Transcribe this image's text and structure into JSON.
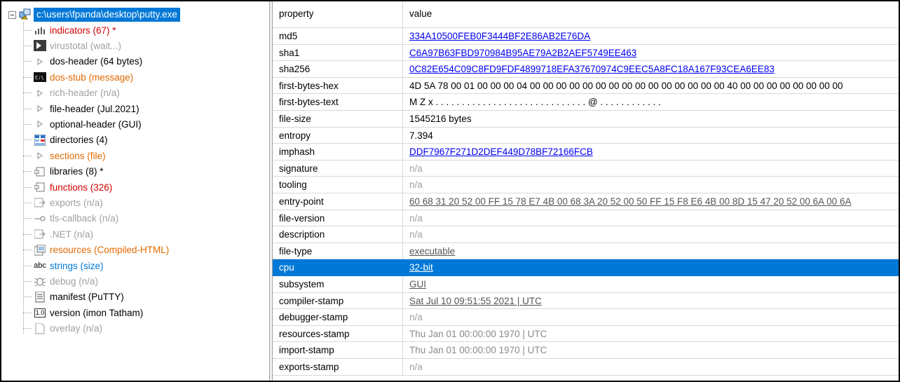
{
  "tree": {
    "root_label": "c:\\users\\fpanda\\desktop\\putty.exe",
    "items": [
      {
        "label": "indicators (67) *",
        "icon": "bars-icon",
        "color": "red"
      },
      {
        "label": "virustotal (wait...)",
        "icon": "virustotal-icon",
        "color": "gray"
      },
      {
        "label": "dos-header (64 bytes)",
        "icon": "triangle-icon",
        "color": "black"
      },
      {
        "label": "dos-stub (message)",
        "icon": "console-icon",
        "color": "orange"
      },
      {
        "label": "rich-header (n/a)",
        "icon": "triangle-icon",
        "color": "gray"
      },
      {
        "label": "file-header (Jul.2021)",
        "icon": "triangle-icon",
        "color": "black"
      },
      {
        "label": "optional-header (GUI)",
        "icon": "triangle-icon",
        "color": "black"
      },
      {
        "label": "directories (4)",
        "icon": "grid-icon",
        "color": "black"
      },
      {
        "label": "sections (file)",
        "icon": "triangle-icon",
        "color": "orange"
      },
      {
        "label": "libraries (8) *",
        "icon": "library-icon",
        "color": "black"
      },
      {
        "label": "functions (326)",
        "icon": "library-icon",
        "color": "red"
      },
      {
        "label": "exports (n/a)",
        "icon": "export-icon",
        "color": "gray"
      },
      {
        "label": "tls-callback (n/a)",
        "icon": "key-icon",
        "color": "gray"
      },
      {
        "label": ".NET (n/a)",
        "icon": "export-icon",
        "color": "gray"
      },
      {
        "label": "resources (Compiled-HTML)",
        "icon": "resources-icon",
        "color": "orange"
      },
      {
        "label": "strings (size)",
        "icon": "abc-icon",
        "color": "blue"
      },
      {
        "label": "debug (n/a)",
        "icon": "bug-icon",
        "color": "gray"
      },
      {
        "label": "manifest (PuTTY)",
        "icon": "manifest-icon",
        "color": "black"
      },
      {
        "label": "version (imon Tatham)",
        "icon": "version-icon",
        "color": "black"
      },
      {
        "label": "overlay (n/a)",
        "icon": "page-icon",
        "color": "gray"
      }
    ],
    "version_icon_text": "1.0",
    "abc_icon_text": "abc"
  },
  "table": {
    "header": {
      "property": "property",
      "value": "value"
    },
    "rows": [
      {
        "key": "md5",
        "value": "334A10500FEB0F3444BF2E86AB2E76DA",
        "style": "link"
      },
      {
        "key": "sha1",
        "value": "C6A97B63FBD970984B95AE79A2B2AEF5749EE463",
        "style": "link"
      },
      {
        "key": "sha256",
        "value": "0C82E654C09C8FD9FDF4899718EFA37670974C9EEC5A8FC18A167F93CEA6EE83",
        "style": "link"
      },
      {
        "key": "first-bytes-hex",
        "value": "4D 5A 78 00 01 00 00 00 04 00 00 00 00 00 00 00 00 00 00 00 00 00 00 00 40 00 00 00 00 00 00 00 00",
        "style": "plain"
      },
      {
        "key": "first-bytes-text",
        "value": "M Z x . . . . . . . . . . . . . . . . . . . . . . . . . . . . . @ . . . . . . . . . . . .",
        "style": "plain"
      },
      {
        "key": "file-size",
        "value": "1545216 bytes",
        "style": "plain"
      },
      {
        "key": "entropy",
        "value": "7.394",
        "style": "plain"
      },
      {
        "key": "imphash",
        "value": "DDF7967F271D2DEF449D78BF72166FCB",
        "style": "link"
      },
      {
        "key": "signature",
        "value": "n/a",
        "style": "na"
      },
      {
        "key": "tooling",
        "value": "n/a",
        "style": "na"
      },
      {
        "key": "entry-point",
        "value": "60 68 31 20 52 00 FF 15 78 E7 4B 00 68 3A 20 52 00 50 FF 15 F8 E6 4B 00 8D 15 47 20 52 00 6A 00 6A",
        "style": "ulgray"
      },
      {
        "key": "file-version",
        "value": "n/a",
        "style": "na"
      },
      {
        "key": "description",
        "value": "n/a",
        "style": "na"
      },
      {
        "key": "file-type",
        "value": "executable",
        "style": "ulgray"
      },
      {
        "key": "cpu",
        "value": "32-bit",
        "style": "link",
        "selected": true
      },
      {
        "key": "subsystem",
        "value": "GUI",
        "style": "ulgray"
      },
      {
        "key": "compiler-stamp",
        "value": "Sat Jul 10 09:51:55 2021 | UTC",
        "style": "ulgray"
      },
      {
        "key": "debugger-stamp",
        "value": "n/a",
        "style": "na"
      },
      {
        "key": "resources-stamp",
        "value": "Thu Jan 01 00:00:00 1970 | UTC",
        "style": "gray"
      },
      {
        "key": "import-stamp",
        "value": "Thu Jan 01 00:00:00 1970 | UTC",
        "style": "gray"
      },
      {
        "key": "exports-stamp",
        "value": "n/a",
        "style": "na"
      }
    ]
  },
  "colors": {
    "selection": "#0078d7",
    "link": "#0000ee",
    "red": "#d00000",
    "orange": "#e06a00",
    "gray": "#a0a0a0"
  }
}
